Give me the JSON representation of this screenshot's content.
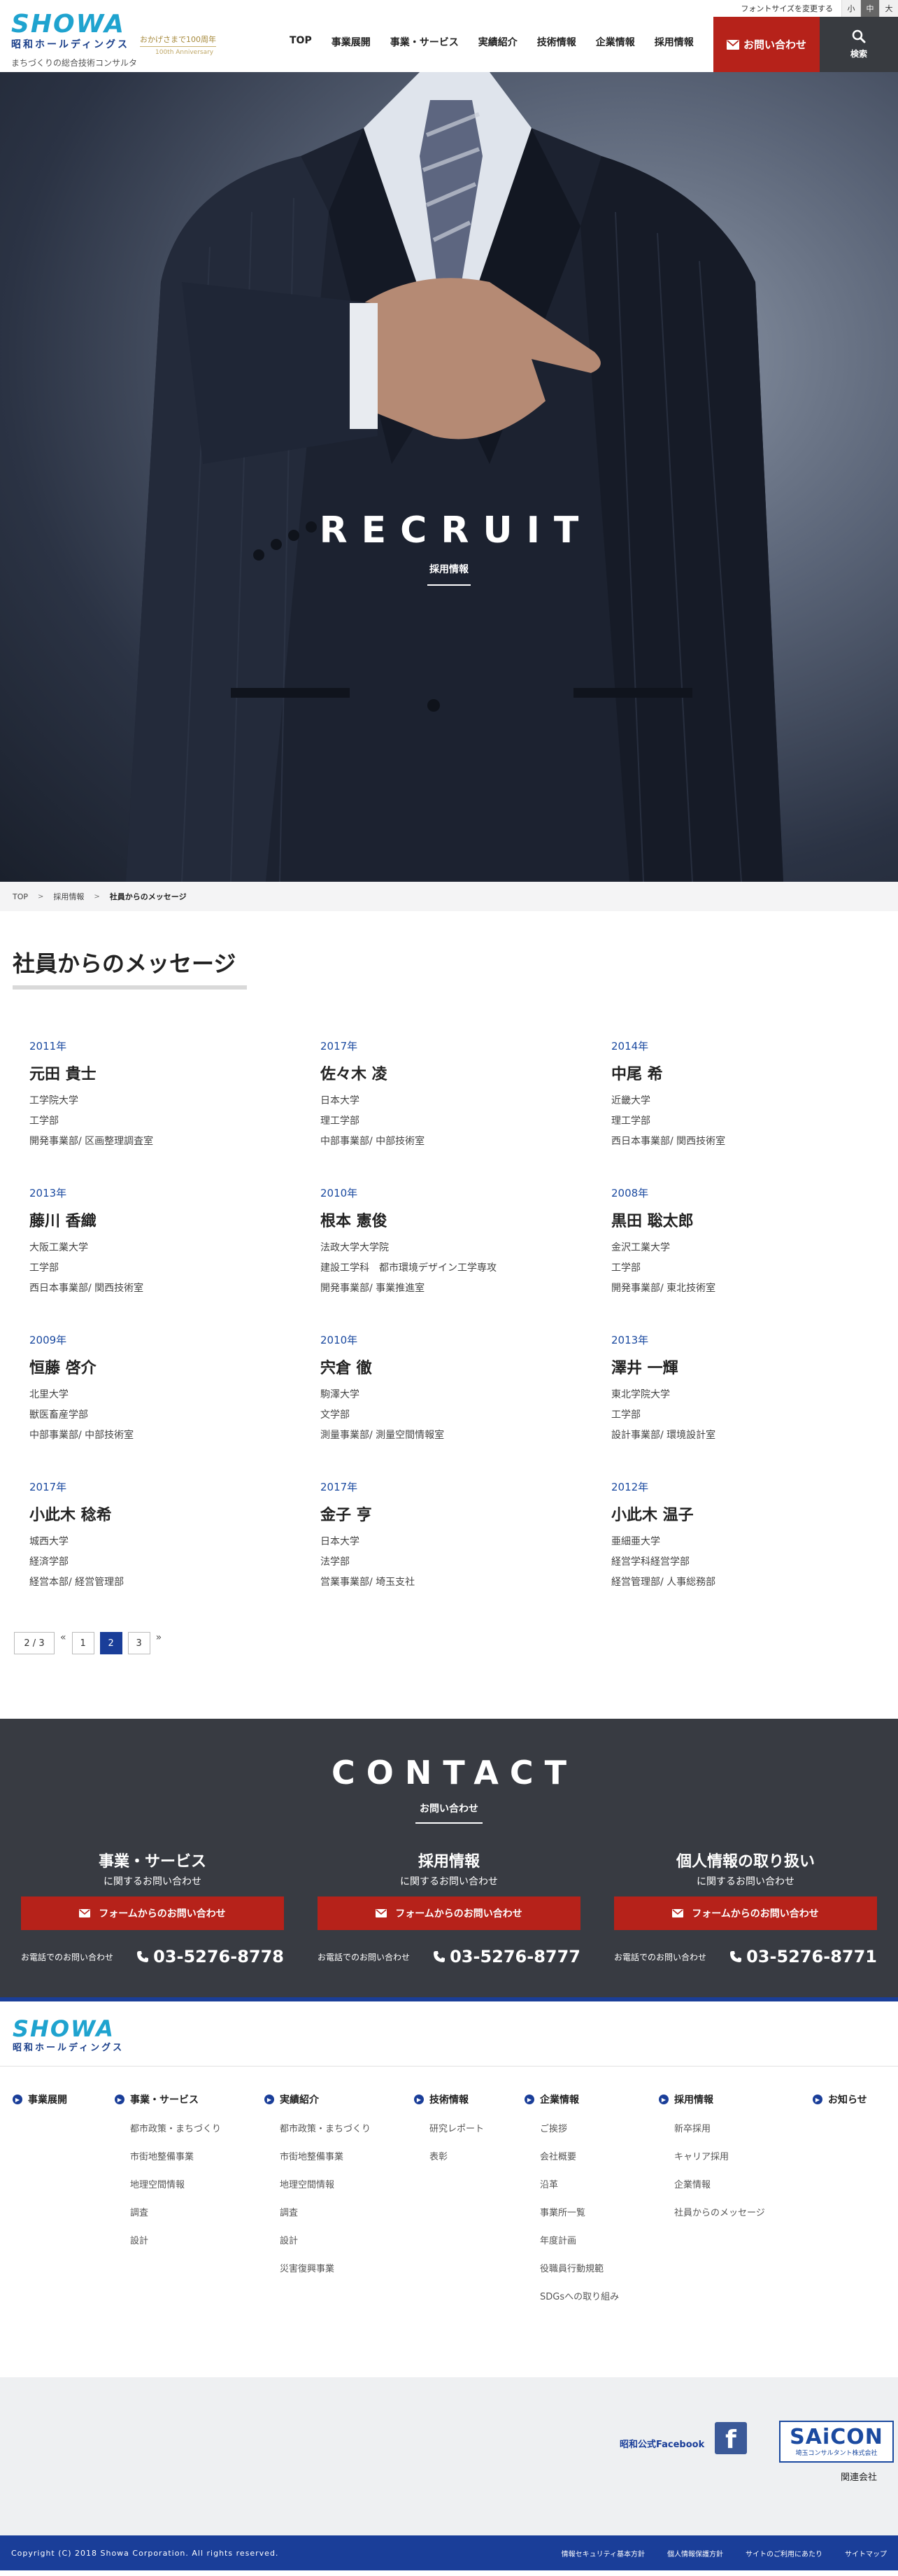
{
  "header": {
    "logo_mark": "SHOWA",
    "logo_jp": "昭和ホールディングス",
    "logo_desc": "まちづくりの総合技術コンサルタント 昭和株式会社",
    "anniv": "おかげさまで100周年",
    "anniv_en": "100th Anniversary",
    "font_size_label": "フォントサイズを変更する",
    "font_sizes": [
      "小",
      "中",
      "大"
    ],
    "nav": [
      "TOP",
      "事業展開",
      "事業・サービス",
      "実績紹介",
      "技術情報",
      "企業情報",
      "採用情報"
    ],
    "contact_label": "お問い合わせ",
    "search_label": "検索"
  },
  "hero": {
    "title": "RECRUIT",
    "subtitle": "採用情報"
  },
  "breadcrumb": [
    "TOP",
    "採用情報",
    "社員からのメッセージ"
  ],
  "page_title": "社員からのメッセージ",
  "staff": [
    {
      "year": "2011年",
      "name": "元田 貴士",
      "lines": [
        "工学院大学",
        "工学部",
        "開発事業部/ 区画整理調査室"
      ]
    },
    {
      "year": "2017年",
      "name": "佐々木 凌",
      "lines": [
        "日本大学",
        "理工学部",
        "中部事業部/ 中部技術室"
      ]
    },
    {
      "year": "2014年",
      "name": "中尾 希",
      "lines": [
        "近畿大学",
        "理工学部",
        "西日本事業部/ 関西技術室"
      ]
    },
    {
      "year": "2013年",
      "name": "藤川 香織",
      "lines": [
        "大阪工業大学",
        "工学部",
        "西日本事業部/ 関西技術室"
      ]
    },
    {
      "year": "2010年",
      "name": "根本 憲俊",
      "lines": [
        "法政大学大学院",
        "建設工学科　都市環境デザイン工学専攻",
        "開発事業部/ 事業推進室"
      ]
    },
    {
      "year": "2008年",
      "name": "黒田 聡太郎",
      "lines": [
        "金沢工業大学",
        "工学部",
        "開発事業部/ 東北技術室"
      ]
    },
    {
      "year": "2009年",
      "name": "恒藤 啓介",
      "lines": [
        "北里大学",
        "獣医畜産学部",
        "中部事業部/ 中部技術室"
      ]
    },
    {
      "year": "2010年",
      "name": "宍倉 徹",
      "lines": [
        "駒澤大学",
        "文学部",
        "測量事業部/ 測量空間情報室"
      ]
    },
    {
      "year": "2013年",
      "name": "澤井 一輝",
      "lines": [
        "東北学院大学",
        "工学部",
        "設計事業部/ 環境設計室"
      ]
    },
    {
      "year": "2017年",
      "name": "小此木 稔希",
      "lines": [
        "城西大学",
        "経済学部",
        "経営本部/ 経営管理部"
      ]
    },
    {
      "year": "2017年",
      "name": "金子 亨",
      "lines": [
        "日本大学",
        "法学部",
        "営業事業部/ 埼玉支社"
      ]
    },
    {
      "year": "2012年",
      "name": "小此木 温子",
      "lines": [
        "亜細亜大学",
        "経営学科経営学部",
        "経営管理部/ 人事総務部"
      ]
    }
  ],
  "pagination": {
    "count": "2 / 3",
    "prev": "«",
    "pages": [
      "1",
      "2",
      "3"
    ],
    "current": "2",
    "next": "»"
  },
  "contact": {
    "title": "CONTACT",
    "subtitle": "お問い合わせ",
    "form_label": "フォームからのお問い合わせ",
    "tel_label": "お電話でのお問い合わせ",
    "columns": [
      {
        "head": "事業・サービス",
        "head2": "に関するお問い合わせ",
        "tel": "03-5276-8778"
      },
      {
        "head": "採用情報",
        "head2": "に関するお問い合わせ",
        "tel": "03-5276-8777"
      },
      {
        "head": "個人情報の取り扱い",
        "head2": "に関するお問い合わせ",
        "tel": "03-5276-8771"
      }
    ]
  },
  "footer": {
    "logo_mark": "SHOWA",
    "logo_jp": "昭和ホールディングス",
    "columns": [
      {
        "head": "事業展開",
        "links": []
      },
      {
        "head": "事業・サービス",
        "links": [
          "都市政策・まちづくり",
          "市街地整備事業",
          "地理空間情報",
          "調査",
          "設計"
        ]
      },
      {
        "head": "実績紹介",
        "links": [
          "都市政策・まちづくり",
          "市街地整備事業",
          "地理空間情報",
          "調査",
          "設計",
          "災害復興事業"
        ]
      },
      {
        "head": "技術情報",
        "links": [
          "研究レポート",
          "表彰"
        ]
      },
      {
        "head": "企業情報",
        "links": [
          "ご挨拶",
          "会社概要",
          "沿革",
          "事業所一覧",
          "年度計画",
          "役職員行動規範",
          "SDGsへの取り組み"
        ]
      },
      {
        "head": "採用情報",
        "links": [
          "新卒採用",
          "キャリア採用",
          "企業情報",
          "社員からのメッセージ"
        ]
      },
      {
        "head": "お知らせ",
        "links": []
      }
    ],
    "facebook_label": "昭和公式Facebook",
    "facebook_icon": "f",
    "saicon_mark": "SAiCON",
    "saicon_sub": "埼玉コンサルタント株式会社",
    "related_label": "関連会社",
    "copyright": "Copyright (C) 2018 Showa Corporation. All rights reserved.",
    "bottom_links": [
      "情報セキュリティ基本方針",
      "個人情報保護方針",
      "サイトのご利用にあたり",
      "サイトマップ"
    ]
  }
}
